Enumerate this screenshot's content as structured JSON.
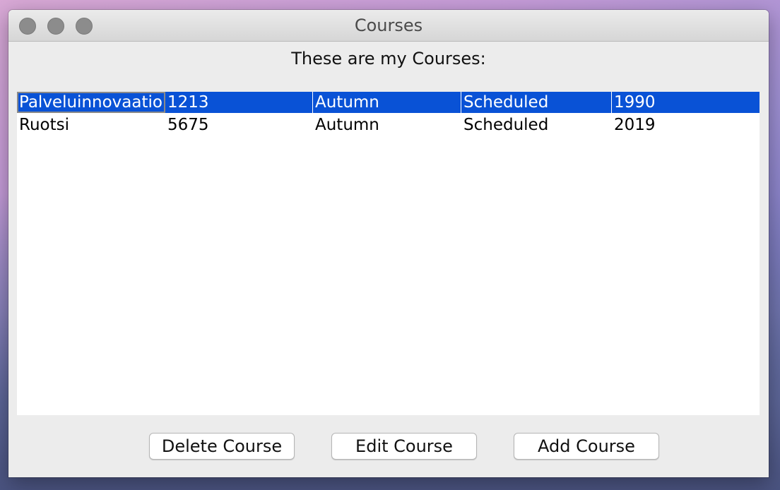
{
  "window": {
    "title": "Courses"
  },
  "heading": "These are my Courses:",
  "courses": {
    "rows": [
      {
        "name": "Palveluinnovaatio",
        "code": "1213",
        "season": "Autumn",
        "status": "Scheduled",
        "year": "1990",
        "selected": true
      },
      {
        "name": "Ruotsi",
        "code": "5675",
        "season": "Autumn",
        "status": "Scheduled",
        "year": "2019",
        "selected": false
      }
    ]
  },
  "buttons": {
    "delete_label": "Delete Course",
    "edit_label": "Edit Course",
    "add_label": "Add Course"
  },
  "colors": {
    "selection": "#0952d6",
    "window_bg": "#ececec"
  }
}
